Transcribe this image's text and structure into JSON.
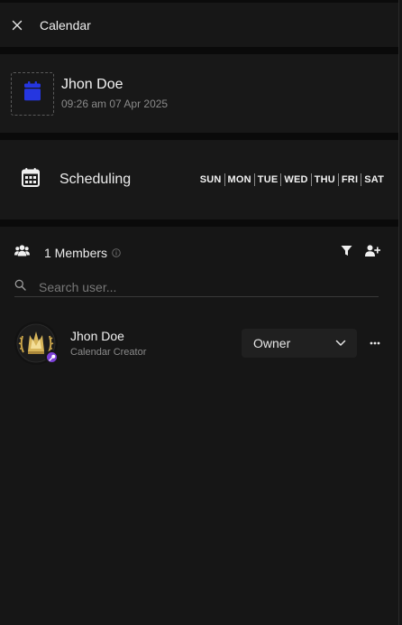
{
  "header": {
    "title": "Calendar"
  },
  "owner": {
    "name": "Jhon Doe",
    "timestamp": "09:26 am 07 Apr 2025"
  },
  "scheduling": {
    "label": "Scheduling",
    "days": [
      "SUN",
      "MON",
      "TUE",
      "WED",
      "THU",
      "FRI",
      "SAT"
    ]
  },
  "members": {
    "count_label": "1 Members",
    "search_placeholder": "Search user...",
    "list": [
      {
        "name": "Jhon Doe",
        "subtitle": "Calendar Creator",
        "role": "Owner"
      }
    ]
  },
  "colors": {
    "accent_blue": "#2536e0",
    "badge_purple": "#7b3fd6",
    "background": "#161616"
  }
}
